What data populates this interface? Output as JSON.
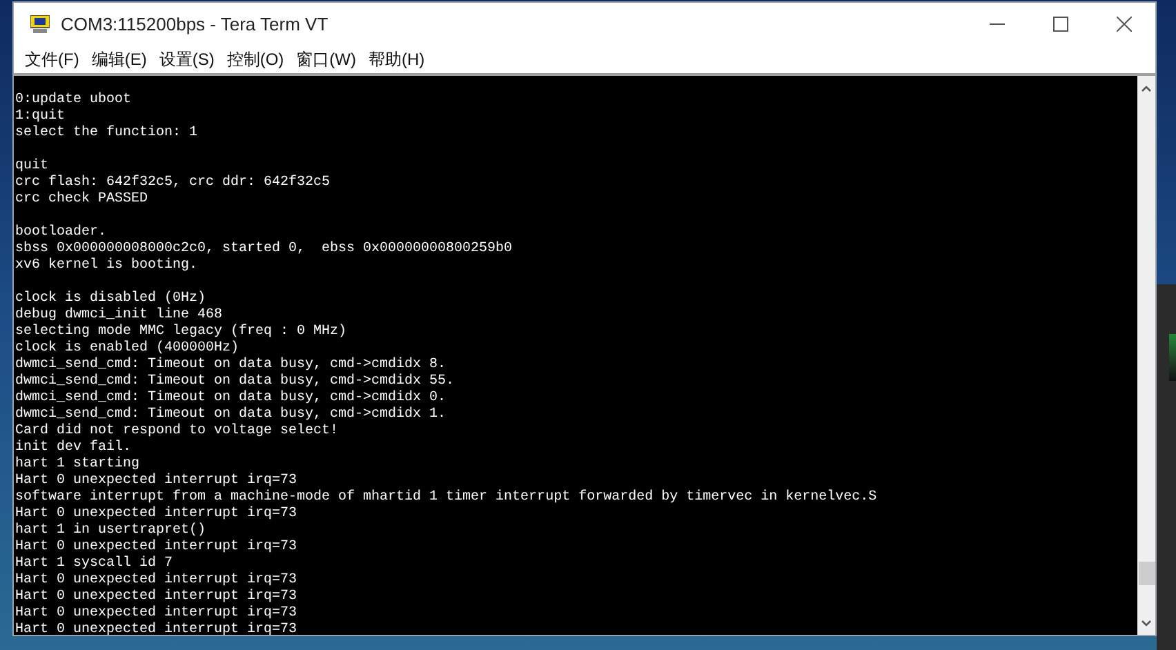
{
  "window": {
    "title": "COM3:115200bps - Tera Term VT"
  },
  "menu": [
    "文件(F)",
    "编辑(E)",
    "设置(S)",
    "控制(O)",
    "窗口(W)",
    "帮助(H)"
  ],
  "terminal": {
    "blocks": [
      [
        "0:update uboot",
        "1:quit",
        "select the function: 1"
      ],
      [
        "quit",
        "crc flash: 642f32c5, crc ddr: 642f32c5",
        "crc check PASSED"
      ],
      [
        "bootloader.",
        "sbss 0x000000008000c2c0, started 0,  ebss 0x00000000800259b0",
        "xv6 kernel is booting."
      ],
      [
        "clock is disabled (0Hz)",
        "debug dwmci_init line 468",
        "selecting mode MMC legacy (freq : 0 MHz)",
        "clock is enabled (400000Hz)",
        "dwmci_send_cmd: Timeout on data busy, cmd->cmdidx 8.",
        "dwmci_send_cmd: Timeout on data busy, cmd->cmdidx 55.",
        "dwmci_send_cmd: Timeout on data busy, cmd->cmdidx 0.",
        "dwmci_send_cmd: Timeout on data busy, cmd->cmdidx 1.",
        "Card did not respond to voltage select!",
        "init dev fail.",
        "hart 1 starting",
        "Hart 0 unexpected interrupt irq=73",
        "software interrupt from a machine-mode of mhartid 1 timer interrupt forwarded by timervec in kernelvec.S",
        "Hart 0 unexpected interrupt irq=73",
        "hart 1 in usertrapret()",
        "Hart 0 unexpected interrupt irq=73",
        "Hart 1 syscall id 7",
        "Hart 0 unexpected interrupt irq=73",
        "Hart 0 unexpected interrupt irq=73",
        "Hart 0 unexpected interrupt irq=73",
        "Hart 0 unexpected interrupt irq=73"
      ]
    ]
  }
}
